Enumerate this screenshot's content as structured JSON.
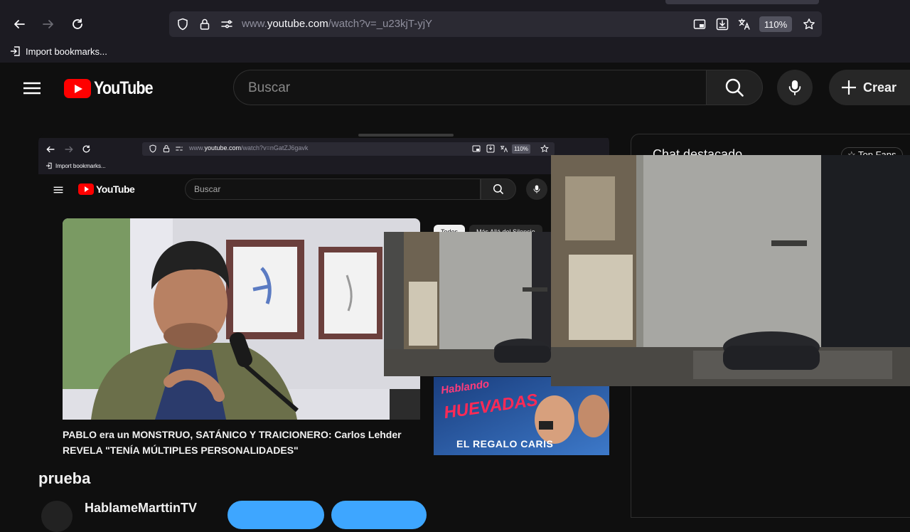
{
  "browser": {
    "url_prefix": "www.",
    "url_host": "youtube.com",
    "url_path": "/watch?v=_u23kjT-yjY",
    "zoom": "110%",
    "bookmarks_label": "Import bookmarks..."
  },
  "youtube": {
    "logo_text": "YouTube",
    "search_placeholder": "Buscar",
    "create_label": "Crear"
  },
  "embedded_capture": {
    "url_prefix": "www.",
    "url_host": "youtube.com",
    "url_path": "/watch?v=nGatZJ6gavk",
    "zoom": "110%",
    "bookmarks_label": "Import bookmarks...",
    "logo_text": "YouTube",
    "search_placeholder": "Buscar",
    "chips": [
      "Todos",
      "Más Allá del Silencio"
    ],
    "video_title": "PABLO era un MONSTRUO, SATÁNICO Y TRAICIONERO: Carlos Lehder REVELA \"TENÍA MÚLTIPLES PERSONALIDADES\"",
    "side_thumb_text_1": "Hablando",
    "side_thumb_text_2": "HUEVADAS",
    "side_thumb_text_3": "EL REGALO CARIS"
  },
  "chat": {
    "title": "Chat destacado",
    "top_chip": "Top Fans"
  },
  "video": {
    "title": "prueba",
    "channel_name": "HablameMarttinTV"
  },
  "colors": {
    "accent_blue": "#3ea6ff",
    "youtube_red": "#ff0000",
    "background": "#0f0f0f"
  }
}
